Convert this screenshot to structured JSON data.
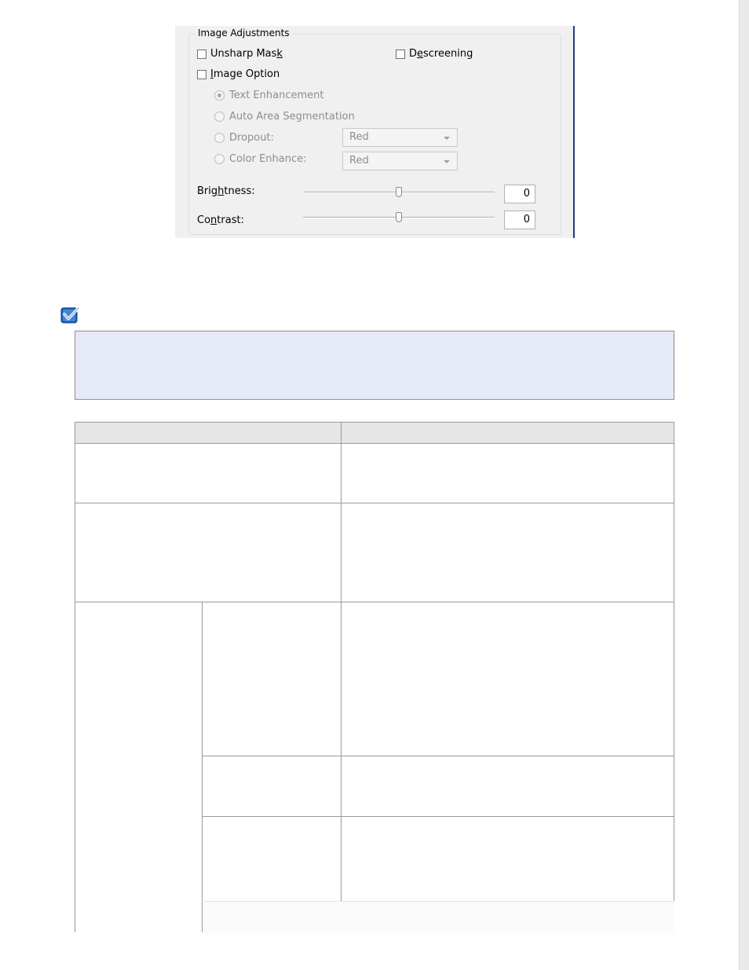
{
  "dialog": {
    "group_title": "Image Adjustments",
    "unsharp_mask": {
      "pre": "Unsharp Mas",
      "key": "k",
      "post": "",
      "checked": false
    },
    "descreening": {
      "pre": "D",
      "key": "e",
      "post": "screening",
      "checked": false
    },
    "image_option": {
      "pre": "",
      "key": "I",
      "post": "mage Option",
      "checked": false
    },
    "radios": [
      {
        "label": "Text Enhancement",
        "selected": true
      },
      {
        "label": "Auto Area Segmentation",
        "selected": false
      },
      {
        "label": "Dropout:",
        "selected": false
      },
      {
        "label": "Color Enhance:",
        "selected": false
      }
    ],
    "dropout_value": "Red",
    "color_enhance_value": "Red",
    "brightness": {
      "pre": "Brig",
      "key": "h",
      "post": "tness:",
      "value": "0"
    },
    "contrast": {
      "pre": "Co",
      "key": "n",
      "post": "trast:",
      "value": "0"
    }
  },
  "icons": {
    "note": "note-check-icon"
  },
  "colors": {
    "note_background": "#e6eaf7",
    "table_header": "#e6e6e6",
    "dialog_background": "#f0f0f0",
    "window_border": "#1c3d7a"
  }
}
